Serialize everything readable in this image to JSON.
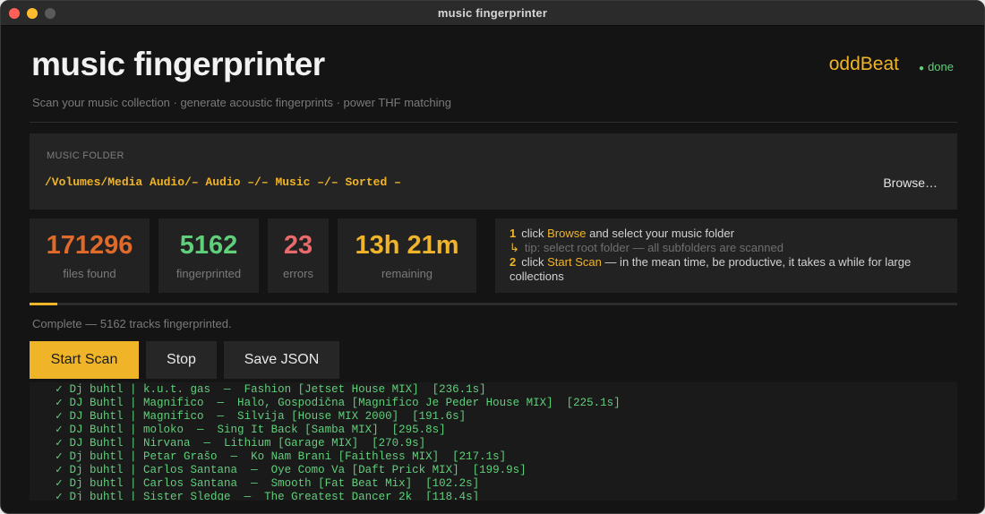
{
  "window": {
    "title": "music fingerprinter"
  },
  "header": {
    "title": "music fingerprinter",
    "subtitle": "Scan your music collection  · generate acoustic fingerprints  · power THF matching",
    "brand": "oddBeat",
    "status_bullet": "●",
    "status": "done"
  },
  "folder": {
    "label": "MUSIC FOLDER",
    "path": "/Volumes/Media Audio/– Audio –/– Music –/– Sorted –",
    "browse_label": "Browse…"
  },
  "stats": [
    {
      "value": "171296",
      "label": "files found",
      "color": "#e06a2a"
    },
    {
      "value": "5162",
      "label": "fingerprinted",
      "color": "#5fcf7a"
    },
    {
      "value": "23",
      "label": "errors",
      "color": "#e86a6a"
    },
    {
      "value": "13h 21m",
      "label": "remaining",
      "color": "#f0b429"
    }
  ],
  "help": {
    "step1_num": "1",
    "step1_pre": "click ",
    "step1_hl": "Browse",
    "step1_post": " and select your music folder",
    "tip_arrow": "↳",
    "tip": "tip: select root folder — all subfolders are scanned",
    "step2_num": "2",
    "step2_pre": "click ",
    "step2_hl": "Start Scan",
    "step2_post": " — in the mean time, be productive, it takes a while for large collections"
  },
  "progress": {
    "fraction": 0.03
  },
  "complete_text": "Complete — 5162 tracks fingerprinted.",
  "buttons": {
    "start": "Start Scan",
    "stop": "Stop",
    "save": "Save JSON"
  },
  "log": {
    "check": "✓",
    "lines": [
      "Dj buhtl | k.u.t. gas  —  Fashion [Jetset House MIX]  [236.1s]",
      "DJ Buhtl | Magnifico  —  Halo, Gospodična [Magnifico Je Peder House MIX]  [225.1s]",
      "DJ Buhtl | Magnifico  —  Silvija [House MIX 2000]  [191.6s]",
      "DJ Buhtl | moloko  —  Sing It Back [Samba MIX]  [295.8s]",
      "DJ Buhtl | Nirvana  —  Lithium [Garage MIX]  [270.9s]",
      "Dj buhtl | Petar Grašo  —  Ko Nam Brani [Faithless MIX]  [217.1s]",
      "Dj buhtl | Carlos Santana  —  Oye Como Va [Daft Prick MIX]  [199.9s]",
      "Dj buhtl | Carlos Santana  —  Smooth [Fat Beat Mix]  [102.2s]",
      "Dj buhtl | Sister Sledge  —  The Greatest Dancer 2k  [118.4s]"
    ]
  }
}
